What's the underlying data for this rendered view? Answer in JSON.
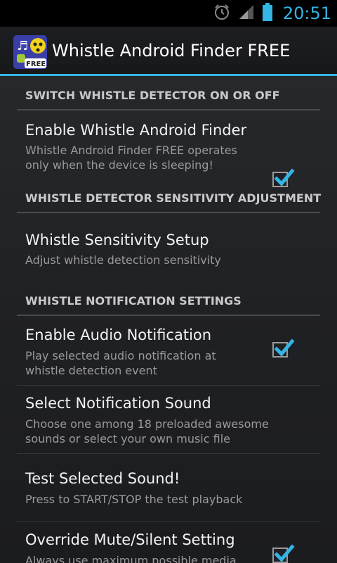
{
  "status": {
    "time": "20:51",
    "icons": [
      "alarm-icon",
      "signal-icon",
      "battery-icon"
    ],
    "accent_color": "#33b5e5"
  },
  "app": {
    "title": "Whistle Android Finder FREE",
    "icon_badge": "FREE"
  },
  "sections": [
    {
      "header": "SWITCH WHISTLE DETECTOR ON OR OFF",
      "items": [
        {
          "title": "Enable Whistle Android Finder",
          "summary": "Whistle Android Finder FREE operates only when the device is sleeping!",
          "checked": true
        }
      ]
    },
    {
      "header": "WHISTLE DETECTOR SENSITIVITY ADJUSTMENT",
      "items": [
        {
          "title": "Whistle Sensitivity Setup",
          "summary": "Adjust whistle detection sensitivity"
        }
      ]
    },
    {
      "header": "WHISTLE NOTIFICATION SETTINGS",
      "items": [
        {
          "title": "Enable Audio Notification",
          "summary": "Play selected audio notification at whistle detection event",
          "checked": true
        },
        {
          "title": "Select Notification Sound",
          "summary": "Choose one among 18 preloaded awesome sounds or select your own music file"
        },
        {
          "title": "Test Selected Sound!",
          "summary": "Press to START/STOP the test playback"
        },
        {
          "title": "Override Mute/Silent Setting",
          "summary": "Always use maximum possible media",
          "checked": true
        }
      ]
    }
  ]
}
